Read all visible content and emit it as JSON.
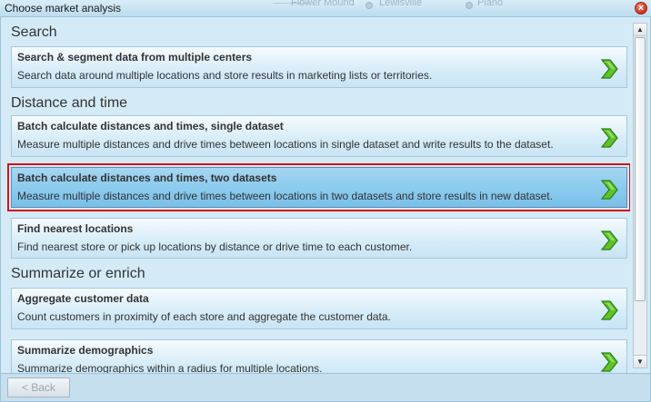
{
  "window": {
    "title": "Choose market analysis",
    "close_glyph": "×"
  },
  "map_background": {
    "labels": [
      "Flower Mound",
      "Lewisville",
      "Plano"
    ]
  },
  "sections": [
    {
      "title": "Search",
      "cards": [
        {
          "title": "Search & segment data from multiple centers",
          "description": "Search data around multiple locations and store results in marketing lists or territories.",
          "icon": "green-chevron-right-icon"
        }
      ]
    },
    {
      "title": "Distance and time",
      "cards": [
        {
          "title": "Batch calculate distances and times, single dataset",
          "description": "Measure multiple distances and drive times between locations in single dataset and write results to the dataset.",
          "icon": "green-chevron-right-icon"
        },
        {
          "title": "Batch calculate distances and times, two datasets",
          "description": "Measure multiple distances and drive times between locations in two datasets and store results in new dataset.",
          "icon": "green-chevron-right-icon",
          "selected": true
        },
        {
          "title": "Find nearest locations",
          "description": "Find nearest store or pick up locations by distance or drive time to each customer.",
          "icon": "green-chevron-right-icon"
        }
      ]
    },
    {
      "title": "Summarize or enrich",
      "cards": [
        {
          "title": "Aggregate customer data",
          "description": "Count customers in proximity of each store and aggregate the customer data.",
          "icon": "green-chevron-right-icon"
        },
        {
          "title": "Summarize demographics",
          "description": "Summarize demographics within a radius for multiple locations.",
          "icon": "green-chevron-right-icon"
        }
      ]
    }
  ],
  "scrollbar": {
    "up_glyph": "▲",
    "down_glyph": "▼"
  },
  "footer": {
    "back_label": "< Back"
  },
  "colors": {
    "selection_outline": "#d4111a",
    "accent_green": "#4caf1e"
  }
}
